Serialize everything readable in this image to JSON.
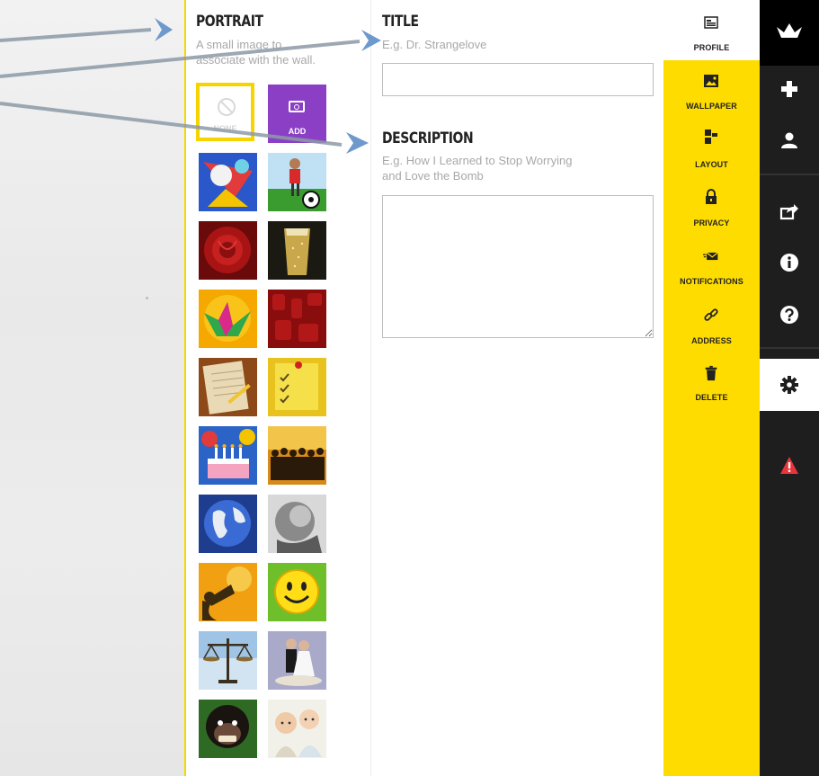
{
  "portrait": {
    "heading": "PORTRAIT",
    "hint_line1": "A small image to",
    "hint_line2": "associate with the wall.",
    "none_label": "NONE",
    "add_label": "ADD",
    "thumbnails": [
      {
        "name": "abstract-colorful"
      },
      {
        "name": "soccer-player"
      },
      {
        "name": "red-rose"
      },
      {
        "name": "champagne-glass"
      },
      {
        "name": "origami-crane"
      },
      {
        "name": "red-pattern"
      },
      {
        "name": "notebook-pencil"
      },
      {
        "name": "sticky-note-checklist"
      },
      {
        "name": "birthday-cake"
      },
      {
        "name": "crowd-silhouettes"
      },
      {
        "name": "globe"
      },
      {
        "name": "bw-sculpture"
      },
      {
        "name": "megaphone-silhouette"
      },
      {
        "name": "smiley-face"
      },
      {
        "name": "scales-of-justice"
      },
      {
        "name": "wedding-cake-topper"
      },
      {
        "name": "chimpanzee"
      },
      {
        "name": "babies"
      }
    ]
  },
  "title_field": {
    "heading": "TITLE",
    "placeholder": "E.g. Dr. Strangelove",
    "value": ""
  },
  "description_field": {
    "heading": "DESCRIPTION",
    "placeholder_line1": "E.g. How I Learned to Stop Worrying",
    "placeholder_line2": "and Love the Bomb",
    "value": ""
  },
  "settings_nav": {
    "items": [
      {
        "label": "PROFILE",
        "icon": "profile-card-icon"
      },
      {
        "label": "WALLPAPER",
        "icon": "image-icon"
      },
      {
        "label": "LAYOUT",
        "icon": "layout-icon"
      },
      {
        "label": "PRIVACY",
        "icon": "lock-icon"
      },
      {
        "label": "NOTIFICATIONS",
        "icon": "envelope-icon"
      },
      {
        "label": "ADDRESS",
        "icon": "link-icon"
      },
      {
        "label": "DELETE",
        "icon": "trash-icon"
      }
    ]
  },
  "dark_sidebar": {
    "items": [
      "crane-logo-icon",
      "plus-icon",
      "user-icon",
      "share-icon",
      "info-icon",
      "help-icon",
      "gear-icon",
      "warning-icon"
    ]
  },
  "colors": {
    "accent_yellow": "#ffdc00",
    "add_purple": "#8a3fc5",
    "sidebar_dark": "#1e1e1e",
    "warning_red": "#e8343b"
  }
}
